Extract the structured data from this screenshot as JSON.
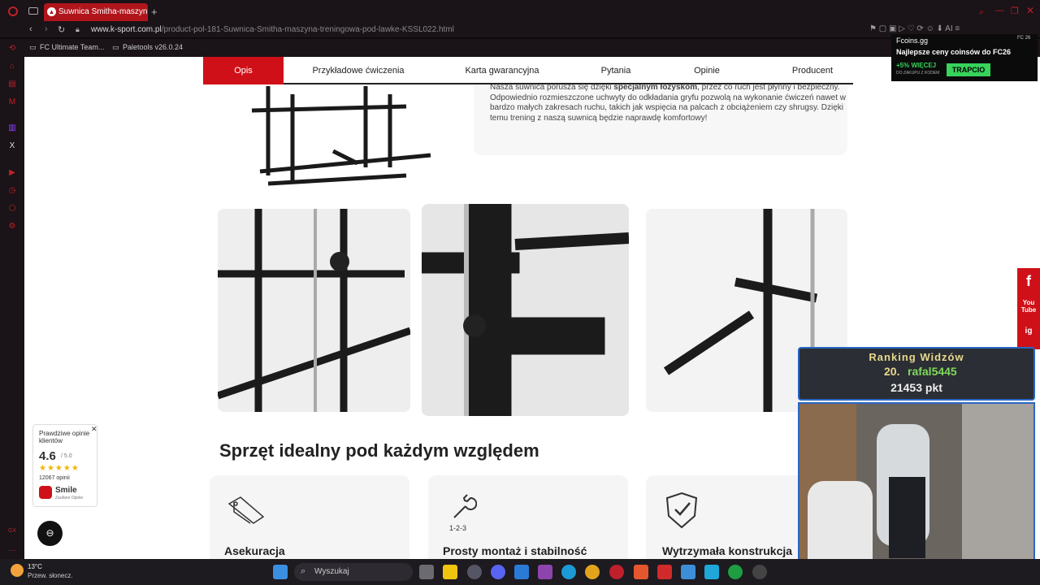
{
  "browser": {
    "tab_title": "Suwnica Smitha-maszyna",
    "url_host": "www.k-sport.com.pl",
    "url_path": "/product-pol-181-Suwnica-Smitha-maszyna-treningowa-pod-lawke-KSSL022.html",
    "bookmarks": [
      "FC Ultimate Team...",
      "Paletools v26.0.24"
    ]
  },
  "product_nav": {
    "tabs": [
      "Opis",
      "Przykładowe ćwiczenia",
      "Karta gwarancyjna",
      "Pytania",
      "Opinie",
      "Producent"
    ]
  },
  "description": {
    "line1_pre": "Nasza suwnica porusza się dzięki ",
    "line1_bold": "specjalnym łożyskom",
    "line1_post": ", przez co ruch jest płynny i",
    "rest": "bezpieczny. Odpowiednio rozmieszczone uchwyty do odkładania gryfu pozwolą na wykonanie ćwiczeń nawet w bardzo małych zakresach ruchu, takich jak wspięcia na palcach z obciążeniem czy shrugsy. Dzięki temu trening z naszą suwnicą będzie naprawdę komfortowy!"
  },
  "section": {
    "heading": "Sprzęt idealny pod każdym względem",
    "features": [
      "Asekuracja",
      "Prosty montaż i stabilność",
      "Wytrzymała konstrukcja"
    ],
    "feature_icon_text": "1-2-3"
  },
  "reviews_widget": {
    "title": "Prawdziwe opinie klientów",
    "score": "4.6",
    "scale": "/ 5.0",
    "count": "12067 opinii",
    "brand": "Smile",
    "brand_sub": "Zaufane Opinie"
  },
  "social": [
    "f",
    "You Tube",
    "ig"
  ],
  "overlay_fcoins": {
    "brand": "Fcoins.gg",
    "tag": "FC 26",
    "headline": "Najlepsze ceny coinsów do FC26",
    "promo": "+5% WIĘCEJ",
    "promo_sub": "DO ZAKUPU Z KODEM",
    "code": "TRAPCIO"
  },
  "overlay_rank": {
    "title": "Ranking Widzów",
    "position": "20.",
    "user": "rafal5445",
    "points": "21453 pkt"
  },
  "taskbar": {
    "weather_temp": "13°C",
    "weather_desc": "Przew. słonecz.",
    "search_placeholder": "Wyszukaj"
  }
}
